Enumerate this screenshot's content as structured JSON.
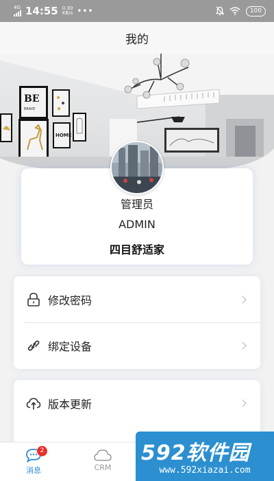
{
  "status_bar": {
    "network": "4G",
    "time": "14:55",
    "speed_value": "0.30",
    "speed_unit": "KB/s",
    "more": "•••",
    "battery": "100"
  },
  "nav": {
    "title": "我的"
  },
  "banner": {
    "frame_be": "BE",
    "frame_brave": "BRAVE",
    "frame_home": "HOME"
  },
  "profile": {
    "role": "管理员",
    "username": "ADMIN",
    "company": "四目舒适家"
  },
  "menu": {
    "group1": [
      {
        "label": "修改密码",
        "icon": "lock-icon"
      },
      {
        "label": "绑定设备",
        "icon": "link-icon"
      }
    ],
    "group2": [
      {
        "label": "版本更新",
        "icon": "cloud-upload-icon"
      }
    ]
  },
  "tab_bar": {
    "tabs": [
      {
        "label": "消息",
        "icon": "chat-icon",
        "active": true,
        "badge": "2"
      },
      {
        "label": "CRM",
        "icon": "cloud-icon",
        "active": false
      }
    ]
  },
  "watermark": {
    "logo": "592软件园",
    "url": "www.592xiazai.com"
  },
  "colors": {
    "accent": "#2f8bd8",
    "badge": "#e8312a",
    "status_bar": "#9a9a9a",
    "watermark_bg": "#2b8fd0"
  }
}
